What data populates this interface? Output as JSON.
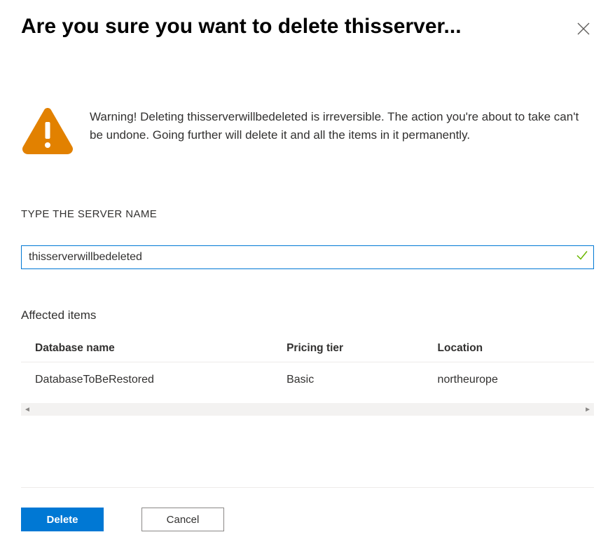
{
  "header": {
    "title": "Are you sure you want to delete thisserver..."
  },
  "warning": {
    "text": "Warning! Deleting thisserverwillbedeleted is irreversible. The action you're about to take can't be undone. Going further will delete it and all the items in it permanently."
  },
  "input": {
    "label": "TYPE THE SERVER NAME",
    "value": "thisserverwillbedeleted"
  },
  "affected": {
    "title": "Affected items",
    "columns": {
      "name": "Database name",
      "tier": "Pricing tier",
      "location": "Location"
    },
    "rows": [
      {
        "name": "DatabaseToBeRestored",
        "tier": "Basic",
        "location": "northeurope"
      }
    ]
  },
  "footer": {
    "delete_label": "Delete",
    "cancel_label": "Cancel"
  }
}
